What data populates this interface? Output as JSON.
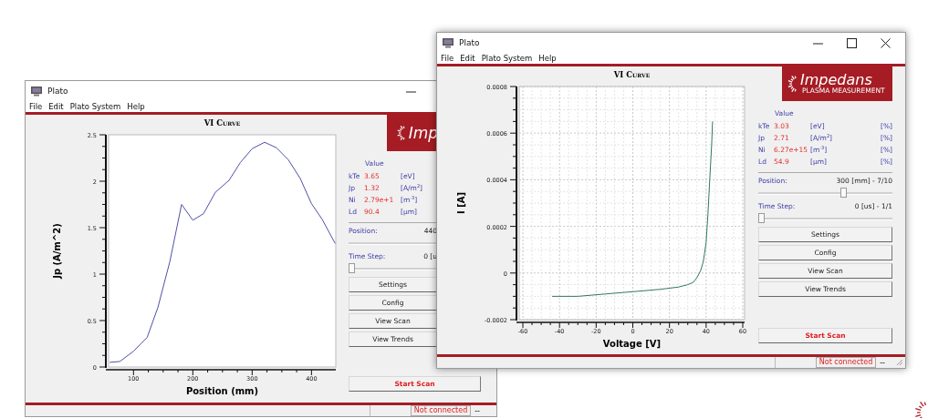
{
  "windows": [
    {
      "title": "Plato",
      "title_buttons": [
        {
          "kind": "minimize"
        }
      ],
      "menu": [
        "File",
        "Edit",
        "Plato System",
        "Help"
      ],
      "logo": {
        "text": "Imp"
      },
      "chart_data": {
        "type": "line",
        "grid": false,
        "title": "VI Curve",
        "xlabel": "Position (mm)",
        "ylabel": "Jp (A/m^2)",
        "xlim": [
          58,
          441
        ],
        "ylim": [
          0,
          2.5
        ],
        "xticks": [
          100,
          200,
          300,
          400
        ],
        "yticks": [
          0,
          0.5,
          1,
          1.5,
          2,
          2.5
        ],
        "x": [
          60,
          77,
          100,
          123,
          141,
          161,
          181,
          200,
          218,
          238,
          261,
          280,
          300,
          321,
          341,
          361,
          381,
          400,
          418,
          440
        ],
        "series": [
          {
            "color": "#5050a8",
            "values": [
              0.05,
              0.06,
              0.17,
              0.32,
              0.64,
              1.13,
              1.75,
              1.58,
              1.65,
              1.88,
              2.01,
              2.2,
              2.35,
              2.42,
              2.36,
              2.23,
              2.03,
              1.76,
              1.59,
              1.33
            ]
          }
        ]
      },
      "parameters": {
        "header": "Value",
        "rows": [
          {
            "name": "kTe",
            "value": "3.65",
            "unit": "[eV]"
          },
          {
            "name": "Jp",
            "value": "1.32",
            "unit": "[A/m$^{2}$]"
          },
          {
            "name": "Ni",
            "value": "2.79e+1",
            "unit": "[m$^{-3}$]"
          },
          {
            "name": "Ld",
            "value": "90.4",
            "unit": "[µm]"
          }
        ]
      },
      "position": {
        "label": "Position:",
        "reading": "440"
      },
      "time_step": {
        "label": "Time Step:",
        "reading": "0 [u",
        "level": 0
      },
      "buttons": [
        "Settings",
        "Config",
        "View Scan",
        "View Trends"
      ],
      "start_button": "Start Scan",
      "status": "Not connected",
      "status_extra": "--"
    },
    {
      "title": "Plato",
      "title_buttons": [
        {
          "kind": "minimize"
        },
        {
          "kind": "maximize"
        },
        {
          "kind": "close"
        }
      ],
      "menu": [
        "File",
        "Edit",
        "Plato System",
        "Help"
      ],
      "logo": {
        "text": "Impedans",
        "subtitle": "PLASMA MEASUREMENT"
      },
      "chart_data": {
        "type": "line",
        "grid": true,
        "title": "VI Curve",
        "xlabel": "Voltage [V]",
        "ylabel": "I [A]",
        "xlim": [
          -62,
          61
        ],
        "ylim": [
          -0.0002,
          0.0008
        ],
        "xticks": [
          -60,
          -40,
          -20,
          0,
          20,
          40,
          60
        ],
        "yticks": [
          -0.0002,
          0,
          0.0002,
          0.0004,
          0.0006,
          0.0008
        ],
        "x": [
          -44,
          -30,
          -15,
          0,
          15,
          25,
          30,
          33,
          35,
          37,
          38.5,
          40,
          41,
          42,
          43,
          43.5
        ],
        "series": [
          {
            "color": "#2f7a5c",
            "values": [
              -0.0001,
              -0.0001,
              -9e-05,
              -8e-05,
              -7e-05,
              -6e-05,
              -5e-05,
              -4e-05,
              -2e-05,
              1e-05,
              5e-05,
              0.00013,
              0.00025,
              0.0004,
              0.00055,
              0.00065
            ]
          }
        ]
      },
      "parameters": {
        "header": "Value",
        "rows": [
          {
            "name": "kTe",
            "value": "3.03",
            "unit": "[eV]",
            "quality": "[%]"
          },
          {
            "name": "Jp",
            "value": "2.71",
            "unit": "[A/m$^{2}$]",
            "quality": "[%]"
          },
          {
            "name": "Ni",
            "value": "6.27e+15",
            "unit": "[m$^{-3}$]",
            "quality": "[%]"
          },
          {
            "name": "Ld",
            "value": "54.9",
            "unit": "[µm]",
            "quality": "[%]"
          }
        ]
      },
      "position": {
        "label": "Position:",
        "reading": "300 [mm] - 7/10",
        "level": 0.64
      },
      "time_step": {
        "label": "Time Step:",
        "reading": "0 [us] - 1/1",
        "level": 0
      },
      "buttons": [
        "Settings",
        "Config",
        "View Scan",
        "View Trends"
      ],
      "start_button": "Start Scan",
      "status": "Not connected",
      "status_extra": "--"
    }
  ]
}
